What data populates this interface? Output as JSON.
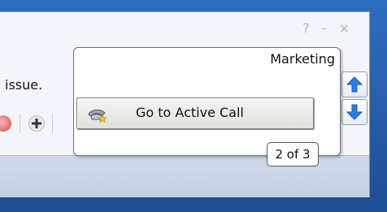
{
  "window": {
    "controls": {
      "help": "?",
      "minimize": "–",
      "close": "×"
    }
  },
  "content": {
    "issue_text": "issue."
  },
  "popup": {
    "title": "Marketing",
    "active_call_button": {
      "label": "Go to Active Call",
      "icon": "phone-star-icon"
    },
    "pager": "2 of 3"
  },
  "navigation": {
    "up_icon": "arrow-up-icon",
    "down_icon": "arrow-down-icon"
  },
  "colors": {
    "desktop": "#2a61b0",
    "window_bg": "#f3f5fa",
    "arrow_blue": "#2f7ae0"
  }
}
